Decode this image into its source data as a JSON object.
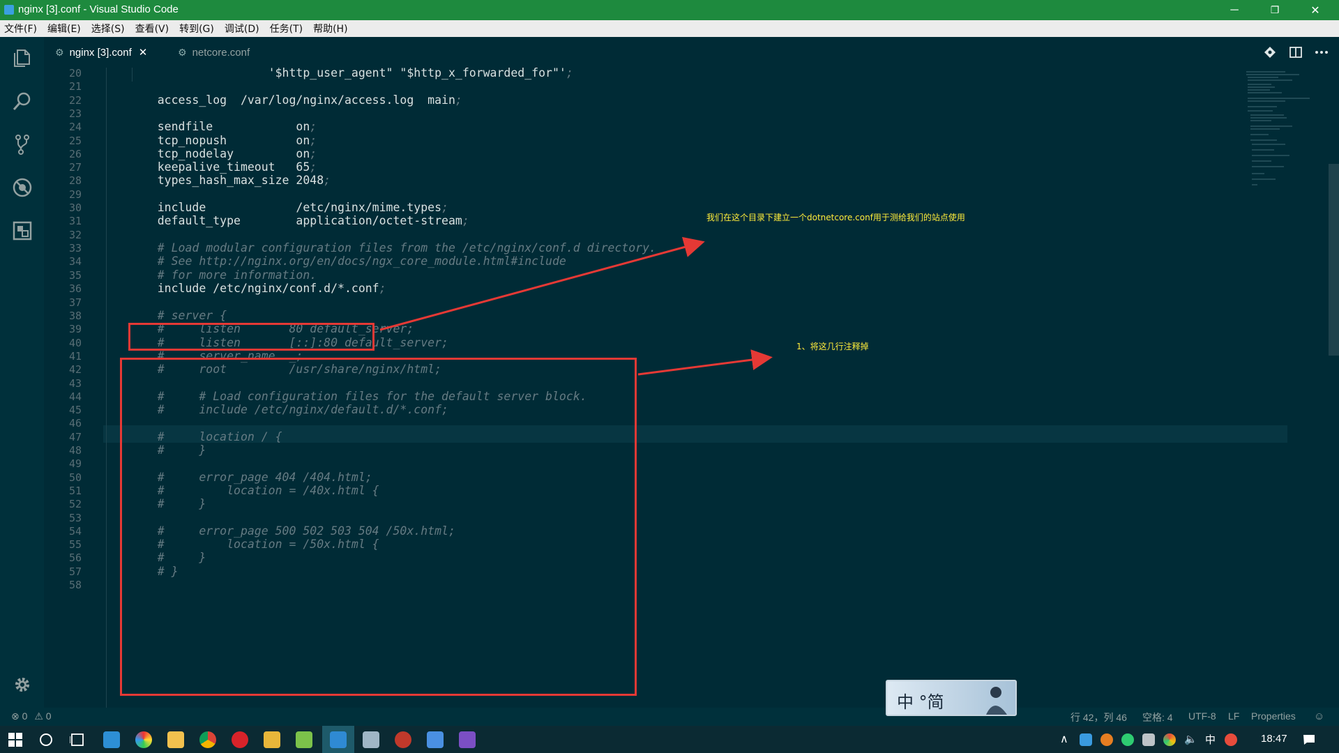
{
  "window": {
    "title": "nginx [3].conf - Visual Studio Code",
    "controls": [
      "─",
      "❐",
      "✕"
    ]
  },
  "menu": [
    "文件(F)",
    "编辑(E)",
    "选择(S)",
    "查看(V)",
    "转到(G)",
    "调试(D)",
    "任务(T)",
    "帮助(H)"
  ],
  "tabs": [
    {
      "label": "nginx [3].conf",
      "close": "✕"
    },
    {
      "label": "netcore.conf"
    }
  ],
  "code": [
    {
      "n": "20",
      "t": "                    '$http_user_agent\" \"$http_x_forwarded_for\"';"
    },
    {
      "n": "21",
      "t": ""
    },
    {
      "n": "22",
      "t": "    access_log  /var/log/nginx/access.log  main;"
    },
    {
      "n": "23",
      "t": ""
    },
    {
      "n": "24",
      "t": "    sendfile            on;"
    },
    {
      "n": "25",
      "t": "    tcp_nopush          on;"
    },
    {
      "n": "26",
      "t": "    tcp_nodelay         on;"
    },
    {
      "n": "27",
      "t": "    keepalive_timeout   65;"
    },
    {
      "n": "28",
      "t": "    types_hash_max_size 2048;"
    },
    {
      "n": "29",
      "t": ""
    },
    {
      "n": "30",
      "t": "    include             /etc/nginx/mime.types;"
    },
    {
      "n": "31",
      "t": "    default_type        application/octet-stream;"
    },
    {
      "n": "32",
      "t": ""
    },
    {
      "n": "33",
      "t": "    # Load modular configuration files from the /etc/nginx/conf.d directory.",
      "comment": true
    },
    {
      "n": "34",
      "t": "    # See http://nginx.org/en/docs/ngx_core_module.html#include",
      "comment": true
    },
    {
      "n": "35",
      "t": "    # for more information.",
      "comment": true
    },
    {
      "n": "36",
      "t": "    include /etc/nginx/conf.d/*.conf;"
    },
    {
      "n": "37",
      "t": ""
    },
    {
      "n": "38",
      "t": "    # server {",
      "comment": true
    },
    {
      "n": "39",
      "t": "    #     listen       80 default_server;",
      "comment": true
    },
    {
      "n": "40",
      "t": "    #     listen       [::]:80 default_server;",
      "comment": true
    },
    {
      "n": "41",
      "t": "    #     server_name  _;",
      "comment": true
    },
    {
      "n": "42",
      "t": "    #     root         /usr/share/nginx/html;",
      "comment": true
    },
    {
      "n": "43",
      "t": ""
    },
    {
      "n": "44",
      "t": "    #     # Load configuration files for the default server block.",
      "comment": true
    },
    {
      "n": "45",
      "t": "    #     include /etc/nginx/default.d/*.conf;",
      "comment": true
    },
    {
      "n": "46",
      "t": ""
    },
    {
      "n": "47",
      "t": "    #     location / {",
      "comment": true
    },
    {
      "n": "48",
      "t": "    #     }",
      "comment": true
    },
    {
      "n": "49",
      "t": ""
    },
    {
      "n": "50",
      "t": "    #     error_page 404 /404.html;",
      "comment": true
    },
    {
      "n": "51",
      "t": "    #         location = /40x.html {",
      "comment": true
    },
    {
      "n": "52",
      "t": "    #     }",
      "comment": true
    },
    {
      "n": "53",
      "t": ""
    },
    {
      "n": "54",
      "t": "    #     error_page 500 502 503 504 /50x.html;",
      "comment": true
    },
    {
      "n": "55",
      "t": "    #         location = /50x.html {",
      "comment": true
    },
    {
      "n": "56",
      "t": "    #     }",
      "comment": true
    },
    {
      "n": "57",
      "t": "    # }",
      "comment": true
    },
    {
      "n": "58",
      "t": ""
    }
  ],
  "annotations": {
    "note1": "我们在这个目录下建立一个dotnetcore.conf用于测给我们的站点使用",
    "note2": "1、将这几行注释掉"
  },
  "status": {
    "errors": "0",
    "warnings": "0",
    "position": "行 42，列 46",
    "spaces": "空格: 4",
    "encoding": "UTF-8",
    "eol": "LF",
    "language": "Properties"
  },
  "badge": {
    "text": "中 °简"
  },
  "clock": "18:47",
  "tray_ime": "中",
  "colors": {
    "titlebar": "#1e8a3e",
    "editor_bg": "#002b36",
    "annotation_red": "#e53935",
    "annotation_text": "#ffeb3b"
  }
}
